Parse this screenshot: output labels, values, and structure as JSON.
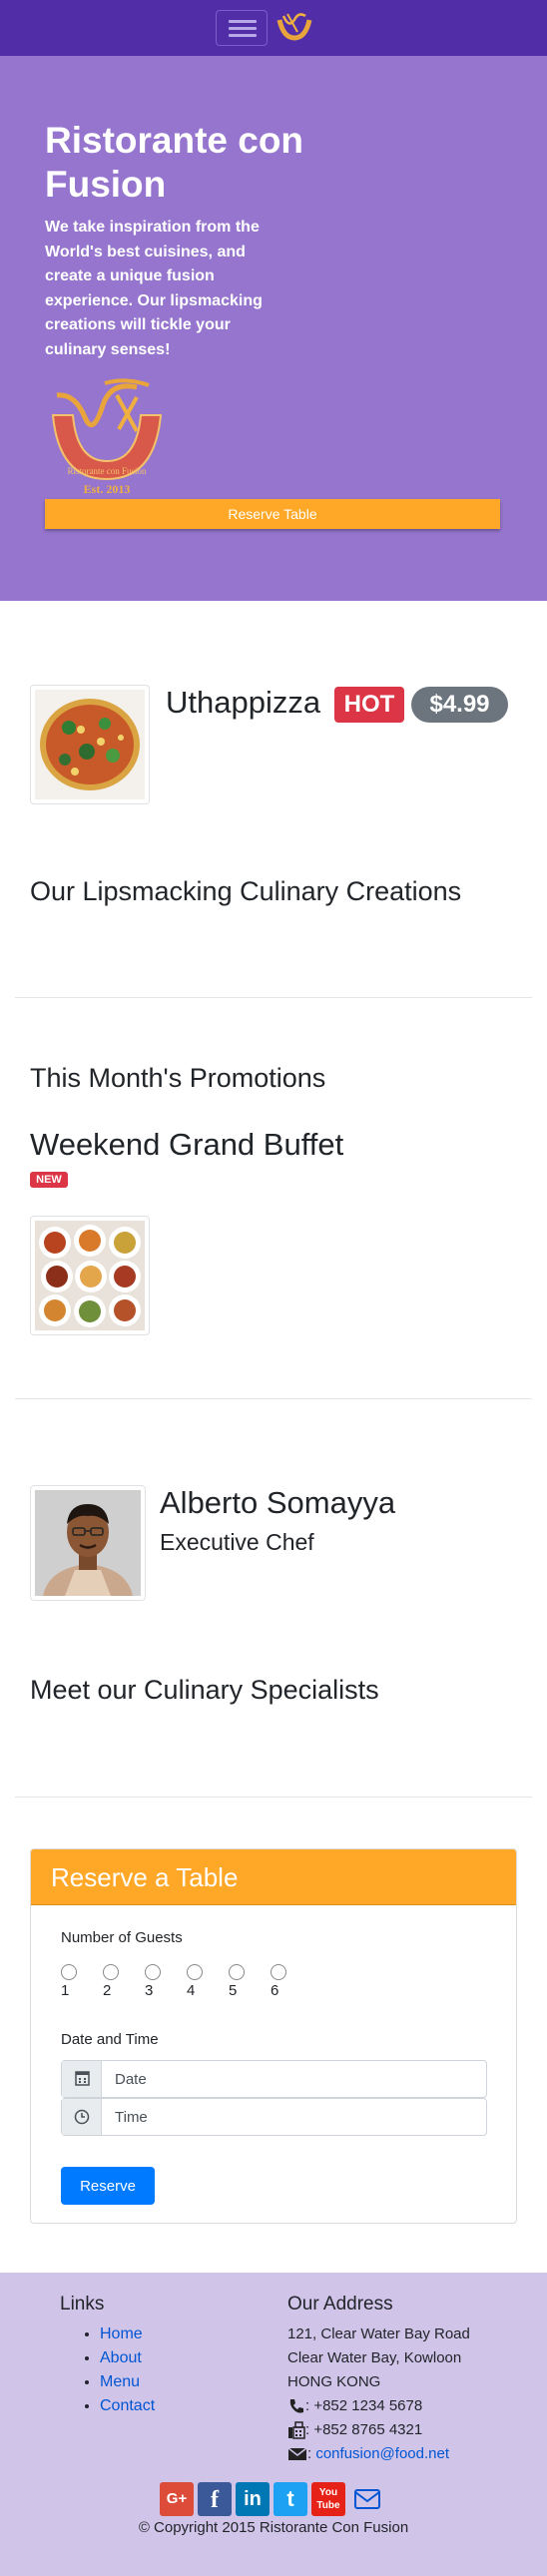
{
  "navbar": {
    "toggler_label": "Toggle navigation",
    "brand_icon": "logo-icon"
  },
  "jumbotron": {
    "title": "Ristorante con Fusion",
    "description": "We take inspiration from the World's best cuisines, and create a unique fusion experience. Our lipsmacking creations will tickle your culinary senses!",
    "logo_text": "Ristorante con Fusion",
    "logo_year": "Est. 2013",
    "reserve_button": "Reserve Table"
  },
  "dish": {
    "name": "Uthappizza",
    "badge": "HOT",
    "price": "$4.99"
  },
  "headings": {
    "creations": "Our Lipsmacking Culinary Creations",
    "promotions": "This Month's Promotions",
    "specialists": "Meet our Culinary Specialists"
  },
  "promotion": {
    "name": "Weekend Grand Buffet",
    "badge": "NEW"
  },
  "leader": {
    "name": "Alberto Somayya",
    "title": "Executive Chef"
  },
  "reserve": {
    "header": "Reserve a Table",
    "guests_label": "Number of Guests",
    "guest_options": [
      "1",
      "2",
      "3",
      "4",
      "5",
      "6"
    ],
    "datetime_label": "Date and Time",
    "date_placeholder": "Date",
    "time_placeholder": "Time",
    "submit_label": "Reserve"
  },
  "footer": {
    "links_heading": "Links",
    "links": [
      "Home",
      "About",
      "Menu",
      "Contact"
    ],
    "address_heading": "Our Address",
    "address_lines": [
      "121, Clear Water Bay Road",
      "Clear Water Bay, Kowloon",
      "HONG KONG"
    ],
    "phone": ": +852 1234 5678",
    "fax": ": +852 8765 4321",
    "email_prefix": ": ",
    "email": "confusion@food.net",
    "social": [
      "G+",
      "f",
      "in",
      "t",
      "You Tube"
    ],
    "copyright": "© Copyright 2015 Ristorante Con Fusion"
  },
  "colors": {
    "navbar": "#512DA8",
    "jumbotron": "#9575CD",
    "accent": "#FFA726",
    "footer": "#D1C4E9",
    "hot": "#dc3545",
    "price": "#6c757d",
    "primary": "#007bff"
  }
}
